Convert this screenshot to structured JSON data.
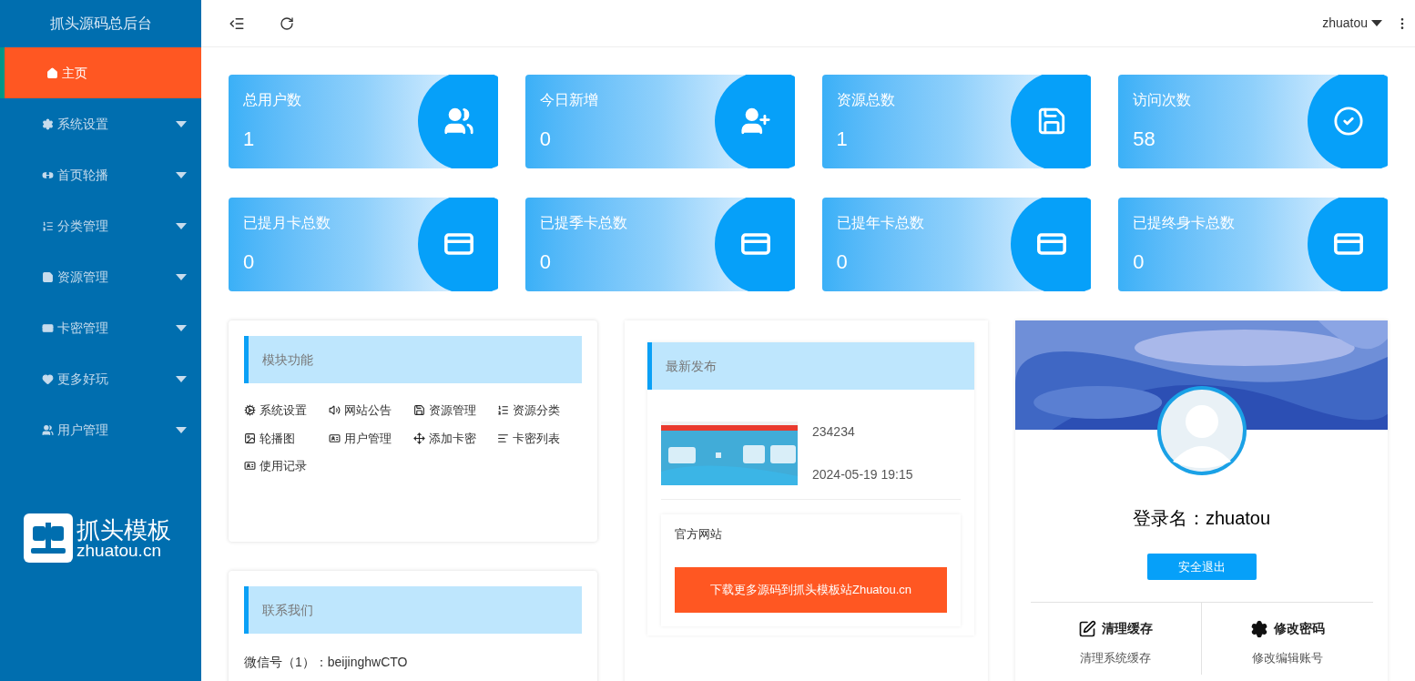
{
  "sidebar": {
    "title": "抓头源码总后台",
    "items": [
      {
        "label": "主页",
        "selected": true,
        "expandable": false
      },
      {
        "label": "系统设置",
        "selected": false,
        "expandable": true
      },
      {
        "label": "首页轮播",
        "selected": false,
        "expandable": true
      },
      {
        "label": "分类管理",
        "selected": false,
        "expandable": true
      },
      {
        "label": "资源管理",
        "selected": false,
        "expandable": true
      },
      {
        "label": "卡密管理",
        "selected": false,
        "expandable": true
      },
      {
        "label": "更多好玩",
        "selected": false,
        "expandable": true
      },
      {
        "label": "用户管理",
        "selected": false,
        "expandable": true
      }
    ],
    "logo": {
      "name": "抓头模板",
      "domain": "zhuatou.cn"
    }
  },
  "header": {
    "user": "zhuatou"
  },
  "stats": [
    {
      "label": "总用户数",
      "value": "1",
      "kind": "users"
    },
    {
      "label": "今日新增",
      "value": "0",
      "kind": "add-user"
    },
    {
      "label": "资源总数",
      "value": "1",
      "kind": "save"
    },
    {
      "label": "访问次数",
      "value": "58",
      "kind": "check"
    },
    {
      "label": "已提月卡总数",
      "value": "0",
      "kind": "card"
    },
    {
      "label": "已提季卡总数",
      "value": "0",
      "kind": "card"
    },
    {
      "label": "已提年卡总数",
      "value": "0",
      "kind": "card"
    },
    {
      "label": "已提终身卡总数",
      "value": "0",
      "kind": "card"
    }
  ],
  "modules": {
    "title": "模块功能",
    "items": [
      "系统设置",
      "网站公告",
      "资源管理",
      "资源分类",
      "轮播图",
      "用户管理",
      "添加卡密",
      "卡密列表",
      "使用记录"
    ]
  },
  "contact": {
    "title": "联系我们",
    "lines": [
      "微信号（1）：beijinghwCTO"
    ]
  },
  "latest": {
    "title": "最新发布",
    "posts": [
      {
        "title": "234234",
        "time": "2024-05-19 19:15"
      }
    ],
    "site": {
      "title": "官方网站",
      "button": "下载更多源码到抓头模板站Zhuatou.cn"
    }
  },
  "profile": {
    "login": "登录名：zhuatou",
    "logout": "安全退出",
    "actions": [
      {
        "title": "清理缓存",
        "desc": "清理系统缓存"
      },
      {
        "title": "修改密码",
        "desc": "修改编辑账号"
      }
    ]
  }
}
